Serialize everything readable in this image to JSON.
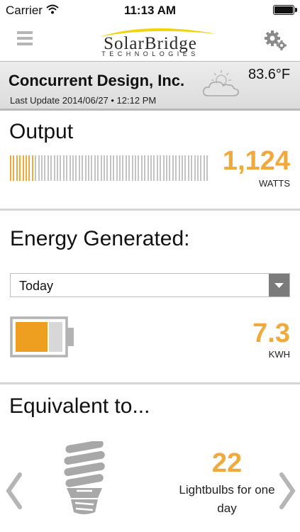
{
  "status_bar": {
    "carrier": "Carrier",
    "time": "11:13 AM",
    "wifi_icon": "wifi-icon",
    "battery_icon": "battery-full-icon"
  },
  "nav": {
    "menu_icon": "hamburger-menu-icon",
    "brand": "SolarBridge",
    "brand_sub": "TECHNOLOGIES",
    "settings_icon": "gear-icon"
  },
  "site": {
    "name": "Concurrent Design, Inc.",
    "last_update": "Last Update 2014/06/27 • 12:12 PM",
    "weather_icon": "partly-cloudy-icon",
    "temperature": "83.6°F"
  },
  "output": {
    "title": "Output",
    "value": "1,124",
    "unit": "WATTS",
    "level_fraction": 0.125
  },
  "energy": {
    "title": "Energy Generated:",
    "period": "Today",
    "value": "7.3",
    "unit": "KWH",
    "battery_level_fraction": 0.68
  },
  "equivalent": {
    "title": "Equivalent to...",
    "icon": "lightbulb-icon",
    "value": "22",
    "description": "Lightbulbs for one day"
  },
  "colors": {
    "accent": "#f0a93c",
    "bar_inactive": "#c4c4c4",
    "battery_fill": "#ee9f1f",
    "header_bg": "#e4e4e4",
    "dropdown_button": "#7b7b7b"
  }
}
